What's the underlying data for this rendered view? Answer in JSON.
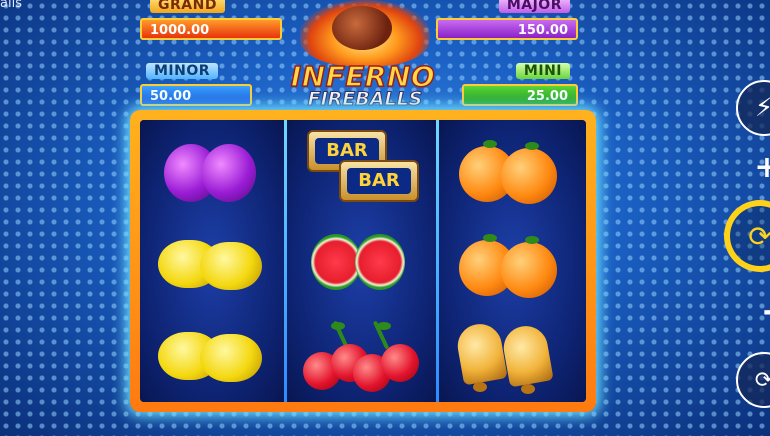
{
  "window": {
    "tab_title": "alls"
  },
  "jackpots": {
    "grand": {
      "label": "GRAND",
      "value": "1000.00"
    },
    "major": {
      "label": "MAJOR",
      "value": "150.00"
    },
    "minor": {
      "label": "MINOR",
      "value": "50.00"
    },
    "mini": {
      "label": "MINI",
      "value": "25.00"
    }
  },
  "logo": {
    "line1": "INFERNO",
    "line2": "FIREBALLS"
  },
  "reels": [
    {
      "symbols": [
        "plums",
        "lemons",
        "lemons"
      ]
    },
    {
      "symbols": [
        "bar",
        "watermelons",
        "cherries"
      ]
    },
    {
      "symbols": [
        "oranges",
        "oranges",
        "bells"
      ]
    }
  ],
  "bar_symbol": {
    "label_top": "BAR",
    "label_bottom": "BAR"
  },
  "controls": {
    "turbo_icon": "lightning-icon",
    "plus_label": "+",
    "spin_icon": "spin-arrow-icon",
    "minus_label": "-",
    "autoplay_icon": "autoplay-icon"
  },
  "colors": {
    "frame": "#ffb21e",
    "spin_ring": "#ffd21a",
    "background": "#1a5fc2"
  }
}
